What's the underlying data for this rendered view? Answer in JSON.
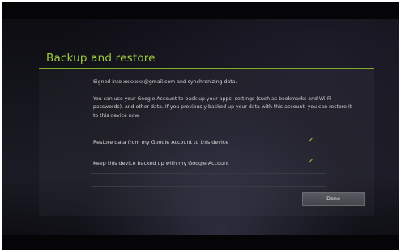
{
  "dialog": {
    "title": "Backup and restore",
    "signed_in_text": "Signed into xxxxxxx@gmail.com and synchronizing data.",
    "description": "You can use your Google Account to back up your apps, settings (such as bookmarks and Wi-Fi passwords), and other data. If you previously backed up your data with this account, you can restore it to this device now.",
    "options": [
      {
        "label": "Restore data from my Google Account to this device",
        "checked": true
      },
      {
        "label": "Keep this device backed up with my Google Account",
        "checked": true
      }
    ],
    "done_label": "Done"
  },
  "colors": {
    "accent": "#9fce3e",
    "check": "#8dbd32",
    "background": "#15151d"
  },
  "icons": {
    "check": "check-icon"
  }
}
